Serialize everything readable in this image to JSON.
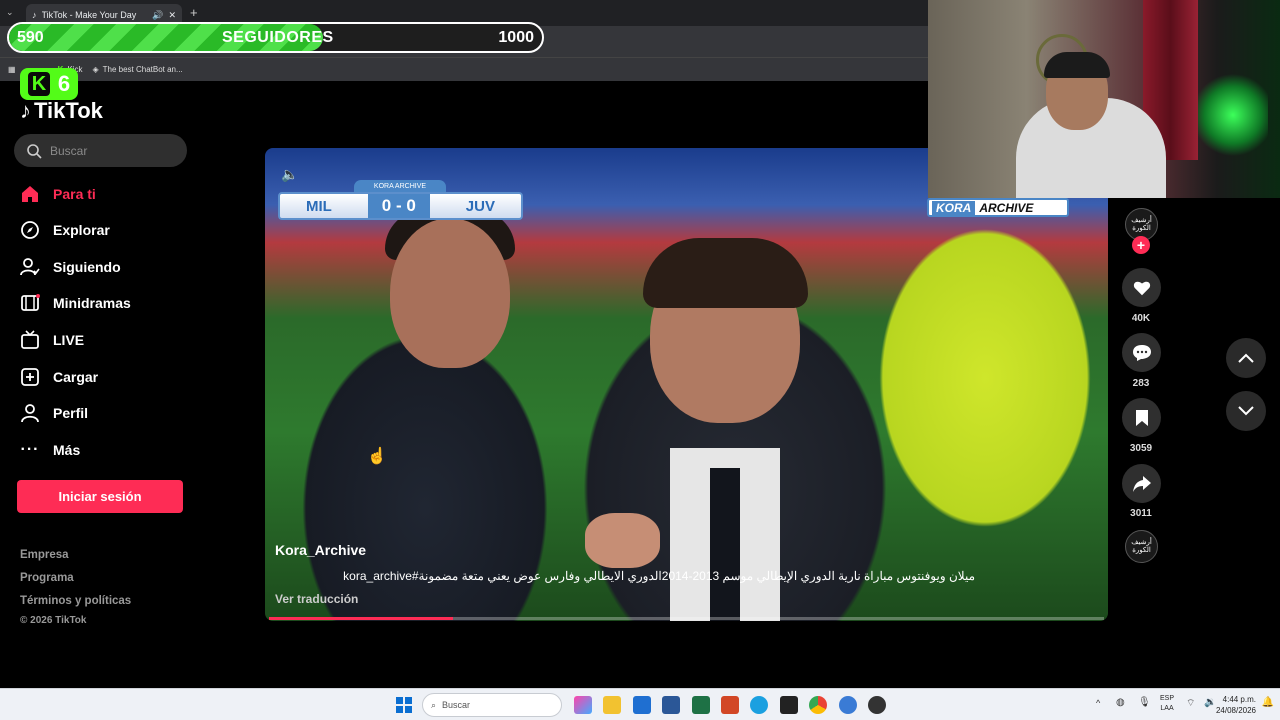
{
  "browser": {
    "tab_title": "TikTok - Make Your Day",
    "bookmarks": [
      "Kick",
      "The best ChatBot an..."
    ]
  },
  "overlay": {
    "followers_current": "590",
    "followers_label": "SEGUIDORES",
    "followers_goal": "1000",
    "followers_progress": 0.59,
    "kick_badge_number": "6"
  },
  "sidebar": {
    "logo_text": "TikTok",
    "search_placeholder": "Buscar",
    "items": [
      {
        "label": "Para ti",
        "icon": "home-icon",
        "active": true
      },
      {
        "label": "Explorar",
        "icon": "compass-icon",
        "active": false
      },
      {
        "label": "Siguiendo",
        "icon": "user-follow-icon",
        "active": false
      },
      {
        "label": "Minidramas",
        "icon": "film-icon",
        "active": false
      },
      {
        "label": "LIVE",
        "icon": "live-tv-icon",
        "active": false
      },
      {
        "label": "Cargar",
        "icon": "upload-plus-icon",
        "active": false
      },
      {
        "label": "Perfil",
        "icon": "person-icon",
        "active": false
      },
      {
        "label": "Más",
        "icon": "more-dots-icon",
        "active": false
      }
    ],
    "login_button": "Iniciar sesión",
    "footer_links": [
      "Empresa",
      "Programa",
      "Términos y políticas"
    ],
    "copyright": "© 2026 TikTok"
  },
  "video": {
    "scoreboard_tag": "KORA ARCHIVE",
    "home_team": "MIL",
    "score": "0 - 0",
    "away_team": "JUV",
    "author": "Kora_Archive",
    "caption": "ميلان ويوفنتوس مباراة نارية الدوري الإيطالي موسم 2013-2014الدوري الايطالي وفارس عوض يعني متعة مضمونة#kora_archive",
    "translate_link": "Ver traducción",
    "progress": 0.22
  },
  "webcam": {
    "tag_highlight": "KORA",
    "tag_rest": "ARCHIVE"
  },
  "actions": {
    "likes": "40K",
    "comments": "283",
    "saves": "3059",
    "shares": "3011",
    "avatar_text": "أرشيف الكورة"
  },
  "taskbar": {
    "search_placeholder": "Buscar",
    "lang_top": "ESP",
    "lang_bottom": "LAA",
    "time": "4:44 p.m.",
    "date": "24/08/2026"
  },
  "colors": {
    "accent": "#fe2c55",
    "progress_green": "#2aba27",
    "kick_green": "#53fc18",
    "scoreboard_blue": "#4a86c6"
  }
}
